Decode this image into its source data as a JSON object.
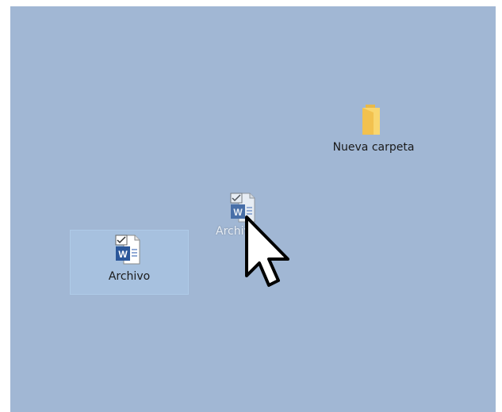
{
  "desktop": {
    "background_color": "#a1b7d4",
    "items": [
      {
        "label": "Nueva carpeta",
        "icon": "folder-icon"
      },
      {
        "label": "Archivo",
        "icon": "word-document-icon",
        "state": "selected"
      },
      {
        "label": "Archivo",
        "icon": "word-document-icon",
        "state": "dragging"
      }
    ]
  },
  "cursor": {
    "icon": "arrow-cursor-icon"
  }
}
